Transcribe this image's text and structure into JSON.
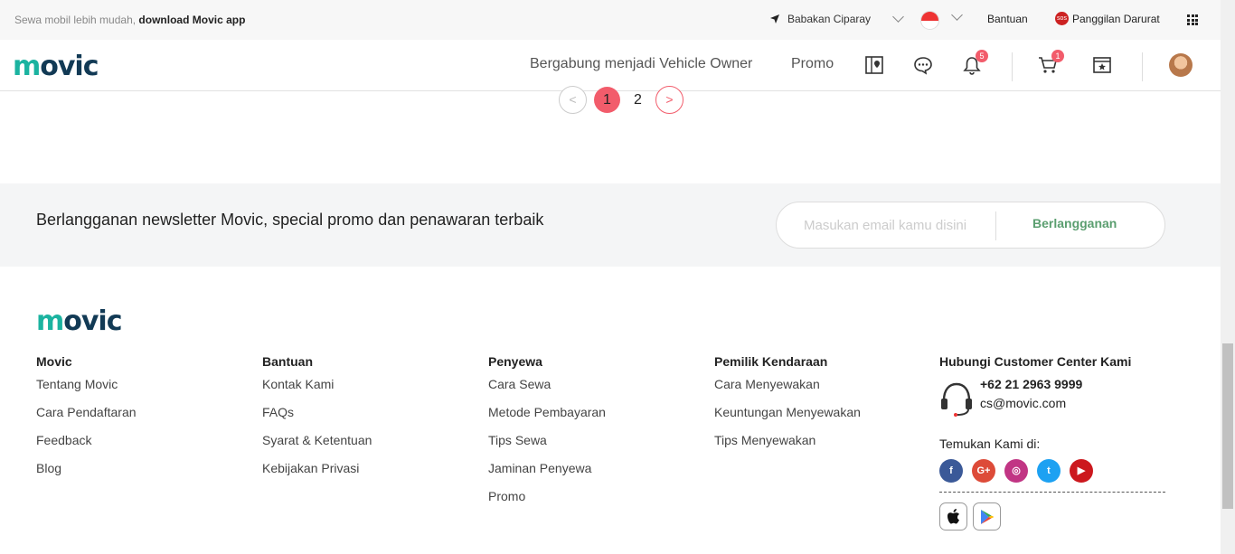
{
  "topbar": {
    "promo_text": "Sewa mobil lebih mudah, ",
    "promo_link": "download Movic app",
    "location": "Babakan Ciparay",
    "help": "Bantuan",
    "emergency": "Panggilan Darurat",
    "sos_label": "sos"
  },
  "nav": {
    "logo": "movic",
    "links": [
      "Bergabung menjadi Vehicle Owner",
      "Promo"
    ],
    "notif_count": "5",
    "cart_count": "1"
  },
  "pagination": {
    "prev": "<",
    "pages": [
      "1",
      "2"
    ],
    "next": ">",
    "current": "1"
  },
  "newsletter": {
    "text": "Berlangganan newsletter Movic, special promo dan penawaran terbaik",
    "placeholder": "Masukan email kamu disini",
    "button": "Berlangganan"
  },
  "footer": {
    "logo": "movic",
    "columns": [
      {
        "title": "Movic",
        "links": [
          "Tentang Movic",
          "Cara Pendaftaran",
          "Feedback",
          "Blog"
        ]
      },
      {
        "title": "Bantuan",
        "links": [
          "Kontak Kami",
          "FAQs",
          "Syarat & Ketentuan",
          "Kebijakan Privasi"
        ]
      },
      {
        "title": "Penyewa",
        "links": [
          "Cara Sewa",
          "Metode Pembayaran",
          "Tips Sewa",
          "Jaminan Penyewa",
          "Promo"
        ]
      },
      {
        "title": "Pemilik Kendaraan",
        "links": [
          "Cara Menyewakan",
          "Keuntungan Menyewakan",
          "Tips Menyewakan"
        ]
      }
    ],
    "contact": {
      "title": "Hubungi Customer Center Kami",
      "phone": "+62 21 2963 9999",
      "email": "cs@movic.com",
      "find_us": "Temukan Kami di:"
    },
    "socials": [
      {
        "name": "facebook-icon",
        "glyph": "f",
        "color": "#3b5998"
      },
      {
        "name": "google-plus-icon",
        "glyph": "G+",
        "color": "#dd4b39"
      },
      {
        "name": "instagram-icon",
        "glyph": "◎",
        "color": "#c13584"
      },
      {
        "name": "twitter-icon",
        "glyph": "t",
        "color": "#1da1f2"
      },
      {
        "name": "youtube-icon",
        "glyph": "▶",
        "color": "#cc181e"
      }
    ]
  },
  "colors": {
    "brand": "#f25c6b",
    "logo_dark": "#123a55",
    "logo_teal": "#1bb3a0",
    "subscribe": "#5a9e6f"
  }
}
